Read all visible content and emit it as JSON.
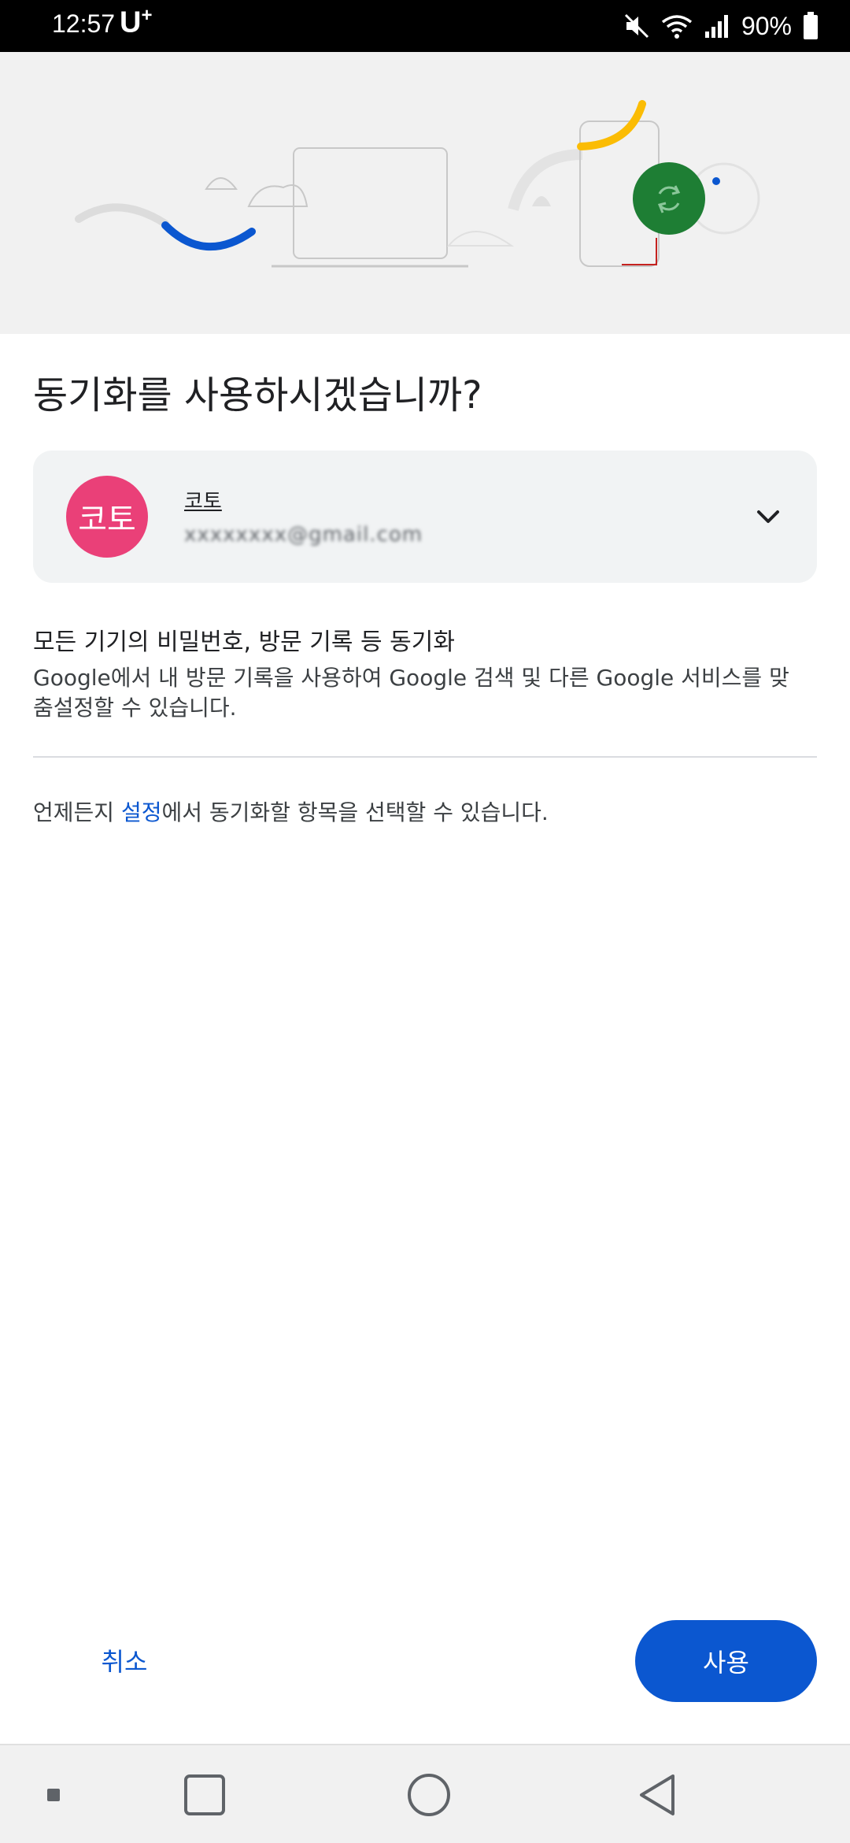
{
  "status_bar": {
    "time": "12:57",
    "carrier": "U",
    "carrier_sup": "+",
    "battery": "90%",
    "icons": [
      "mute-icon",
      "wifi-icon",
      "signal-icon",
      "battery-icon"
    ]
  },
  "hero": {
    "sync_icon": "sync-icon",
    "colors": {
      "background": "#f1f1f1",
      "blue": "#0b57d0",
      "yellow": "#fbbc04",
      "green": "#1e7e34",
      "red": "#c5221f"
    }
  },
  "dialog": {
    "title": "동기화를 사용하시겠습니까?",
    "account": {
      "avatar_text": "코토",
      "name": "코토",
      "email": "xxxxxxxx@gmail.com",
      "avatar_color": "#ea4078"
    },
    "sync_heading": "모든 기기의 비밀번호, 방문 기록 등 동기화",
    "sync_desc": "Google에서 내 방문 기록을 사용하여 Google 검색 및 다른 Google 서비스를 맞춤설정할 수 있습니다.",
    "note_prefix": "언제든지 ",
    "note_link": "설정",
    "note_suffix": "에서 동기화할 항목을 선택할 수 있습니다."
  },
  "buttons": {
    "cancel": "취소",
    "use": "사용",
    "accent": "#0b57d0"
  },
  "nav": {
    "items": [
      "recent-dot-icon",
      "overview-square-icon",
      "home-circle-icon",
      "back-triangle-icon"
    ]
  }
}
